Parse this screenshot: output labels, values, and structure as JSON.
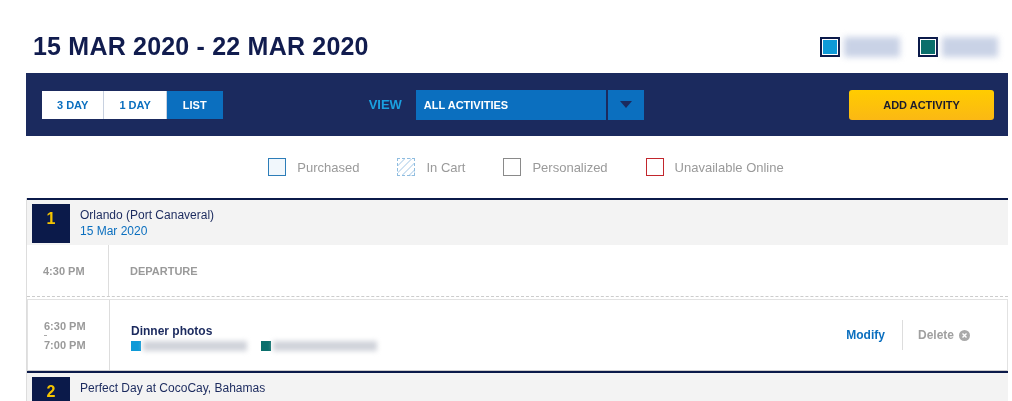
{
  "title": "15 MAR 2020 - 22 MAR 2020",
  "guests": [
    {
      "color": "#0e9ad7"
    },
    {
      "color": "#0a6f6c"
    }
  ],
  "toolbar": {
    "tabs": [
      {
        "label": "3 DAY",
        "selected": false
      },
      {
        "label": "1 DAY",
        "selected": false
      },
      {
        "label": "LIST",
        "selected": true
      }
    ],
    "view_label": "VIEW",
    "view_select": {
      "value": "ALL ACTIVITIES"
    },
    "add_button": "ADD ACTIVITY"
  },
  "legend": [
    {
      "kind": "purchased",
      "label": "Purchased"
    },
    {
      "kind": "in_cart",
      "label": "In Cart"
    },
    {
      "kind": "personalized",
      "label": "Personalized"
    },
    {
      "kind": "unavailable",
      "label": "Unavailable Online"
    }
  ],
  "days": [
    {
      "number": "1",
      "place": "Orlando (Port Canaveral)",
      "date": "15 Mar 2020",
      "events": [
        {
          "kind": "port",
          "time": "4:30 PM",
          "label": "DEPARTURE"
        },
        {
          "kind": "activity",
          "start": "6:30 PM",
          "end": "7:00 PM",
          "title": "Dinner photos",
          "guests": [
            {
              "color": "#0e9ad7"
            },
            {
              "color": "#0a6f6c"
            }
          ],
          "actions": {
            "modify": "Modify",
            "delete": "Delete"
          }
        }
      ]
    },
    {
      "number": "2",
      "place": "Perfect Day at CocoCay, Bahamas"
    }
  ]
}
